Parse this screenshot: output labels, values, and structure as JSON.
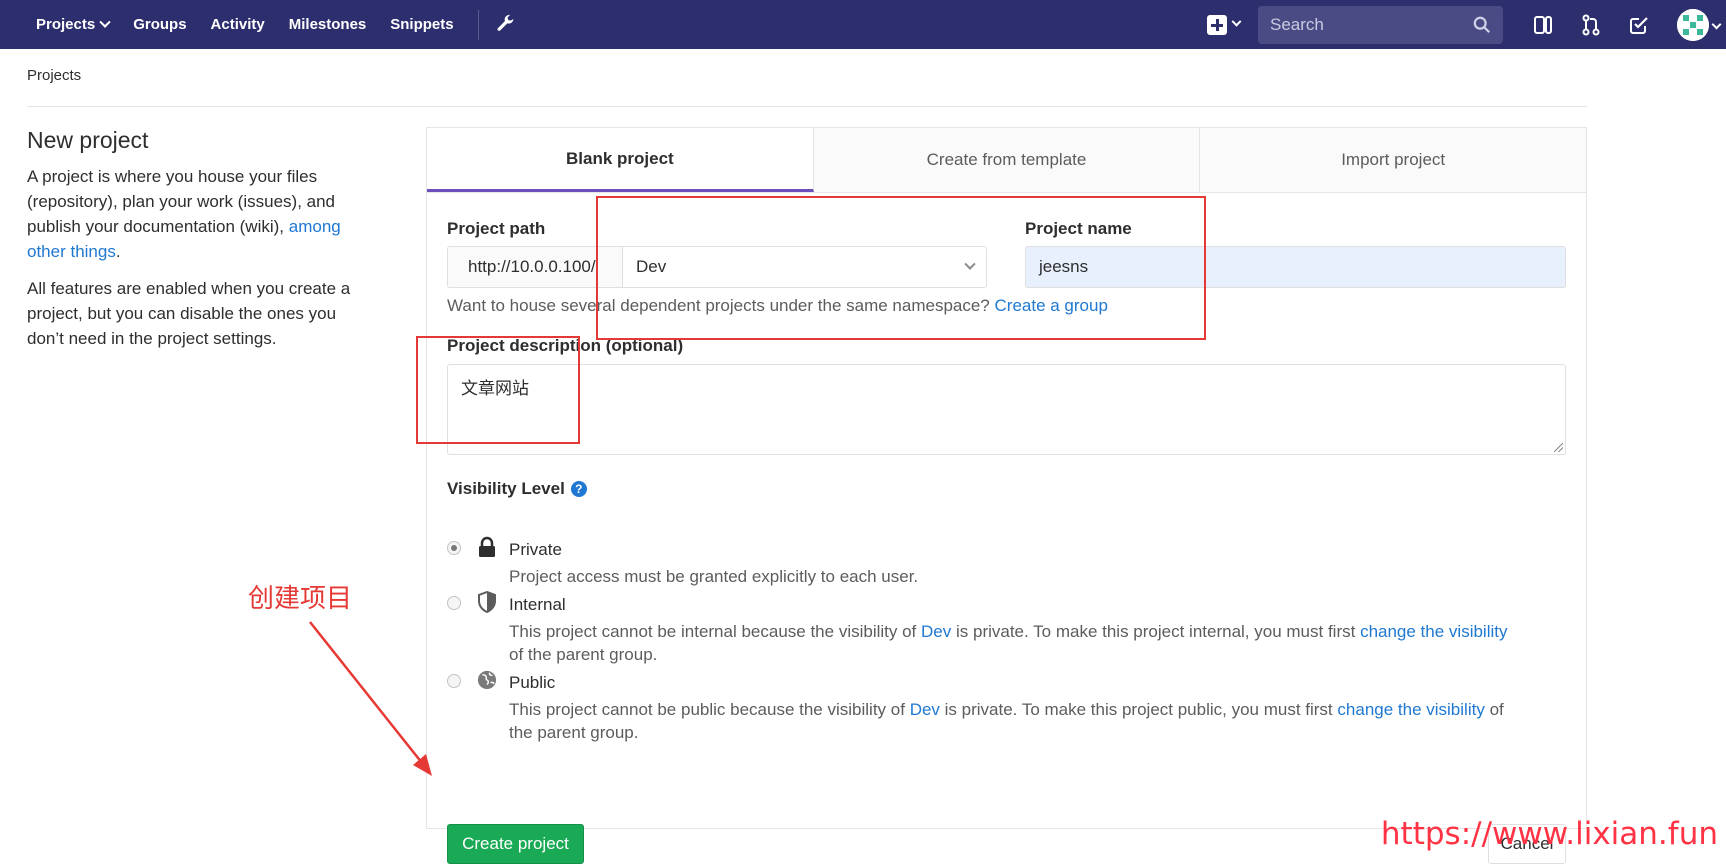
{
  "navbar": {
    "projects": "Projects",
    "groups": "Groups",
    "activity": "Activity",
    "milestones": "Milestones",
    "snippets": "Snippets",
    "search_placeholder": "Search"
  },
  "breadcrumb": "Projects",
  "sidebar": {
    "title": "New project",
    "para1_text": "A project is where you house your files (repository), plan your work (issues), and publish your documentation (wiki),",
    "para1_link": "among other things",
    "para1_end": ".",
    "para2": "All features are enabled when you create a project, but you can disable the ones you don’t need in the project settings."
  },
  "tabs": [
    "Blank project",
    "Create from template",
    "Import project"
  ],
  "form": {
    "path_label": "Project path",
    "path_prefix": "http://10.0.0.100/",
    "path_namespace": "Dev",
    "name_label": "Project name",
    "name_value": "jeesns",
    "help_text": "Want to house several dependent projects under the same namespace?",
    "help_link": "Create a group",
    "desc_label": "Project description (optional)",
    "desc_value": "文章网站",
    "visibility_label": "Visibility Level",
    "visibility_options": [
      {
        "title": "Private",
        "desc": "Project access must be granted explicitly to each user.",
        "checked": true
      },
      {
        "title": "Internal",
        "desc_a": "This project cannot be internal because the visibility of",
        "desc_group": "Dev",
        "desc_b": "is private. To make this project internal, you must first",
        "desc_link": "change the visibility",
        "desc_c": "of the parent group."
      },
      {
        "title": "Public",
        "desc_a": "This project cannot be public because the visibility of",
        "desc_group": "Dev",
        "desc_b": "is private. To make this project public, you must first",
        "desc_link": "change the visibility",
        "desc_c": "of the parent group."
      }
    ],
    "create_button": "Create project",
    "cancel_button": "Cancel"
  },
  "annotation": {
    "label": "创建项目",
    "color": "#e53935"
  },
  "watermark": "https://www.lixian.fun",
  "colors": {
    "navbar": "#2d2e6e",
    "link": "#1f78d1",
    "primary_button": "#1aaa55",
    "active_tab_border": "#6b4fbb"
  }
}
